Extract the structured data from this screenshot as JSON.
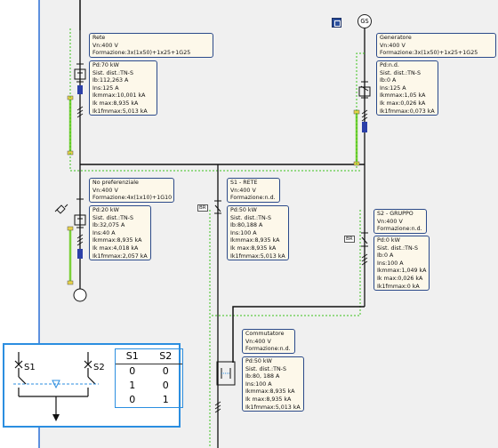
{
  "nodes": {
    "rete": {
      "lines": [
        "Rete",
        "Vn:400 V",
        "Formazione:3x(1x50)+1x25+1G25"
      ]
    },
    "rete_calc": {
      "lines": [
        "Pd:70 kW",
        "Sist. dist.:TN-S",
        "Ib:112,263 A",
        "Ins:125 A",
        "Ikmmax:10,001 kA",
        "Ik max:8,935 kA",
        "Ik1fmmax:5,013 kA"
      ]
    },
    "generatore": {
      "lines": [
        "Generatore",
        "Vn:400 V",
        "Formazione:3x(1x50)+1x25+1G25"
      ]
    },
    "generatore_calc": {
      "lines": [
        "Pd:n.d.",
        "Sist. dist.:TN-S",
        "Ib:0 A",
        "Ins:125 A",
        "Ikmmax:1,05 kA",
        "Ik max:0,026 kA",
        "Ik1fmmax:0,073 kA"
      ]
    },
    "no_pref": {
      "lines": [
        "No preferenziale",
        "Vn:400 V",
        "Formazione:4x(1x10)+1G10"
      ]
    },
    "no_pref_calc": {
      "lines": [
        "Pd:20 kW",
        "Sist. dist.:TN-S",
        "Ib:32,075 A",
        "Ins:40 A",
        "Ikmmax:8,935 kA",
        "Ik max:4,018 kA",
        "Ik1fmmax:2,057 kA"
      ]
    },
    "s1": {
      "lines": [
        "S1 - RETE",
        "Vn:400 V",
        "Formazione:n.d."
      ]
    },
    "s1_calc": {
      "lines": [
        "Pd:50 kW",
        "Sist. dist.:TN-S",
        "Ib:80,188 A",
        "Ins:100 A",
        "Ikmmax:8,935 kA",
        "Ik max:8,935 kA",
        "Ik1fmmax:5,013 kA"
      ]
    },
    "s2": {
      "lines": [
        "S2 - GRUPPO",
        "Vn:400 V",
        "Formazione:n.d."
      ]
    },
    "s2_calc": {
      "lines": [
        "Pd:0 kW",
        "Sist. dist.:TN-S",
        "Ib:0 A",
        "Ins:100 A",
        "Ikmmax:1,049 kA",
        "Ik max:0,026 kA",
        "Ik1fmmax:0 kA"
      ]
    },
    "comm": {
      "lines": [
        "Commutatore",
        "Vn:400 V",
        "Formazione:n.d."
      ]
    },
    "comm_calc": {
      "lines": [
        "Pd:50 kW",
        "Sist. dist.:TN-S",
        "Ib:80, 188 A",
        "Ins:100 A",
        "Ikmmax:8,935 kA",
        "Ik max:8,935 kA",
        "Ik1fmmax:5,013 kA"
      ]
    }
  },
  "gs_label": "GS",
  "small_tag": "BR",
  "legend": {
    "s1_label": "S1",
    "s2_label": "S2",
    "table_header": [
      "S1",
      "S2"
    ],
    "table_rows": [
      [
        "0",
        "0"
      ],
      [
        "1",
        "0"
      ],
      [
        "0",
        "1"
      ]
    ]
  },
  "colors": {
    "box_fill": "#fdf8ea",
    "box_border": "#2b4a8a",
    "green_dashed": "#3cc21c",
    "green_bar": "#7bd138",
    "blue_fuse": "#2b3fa8",
    "yellow_tab": "#e6d24a",
    "legend_border": "#2b8ee0",
    "canvas_bg": "#f0f0f0",
    "frame_line": "#2a6fd6"
  }
}
